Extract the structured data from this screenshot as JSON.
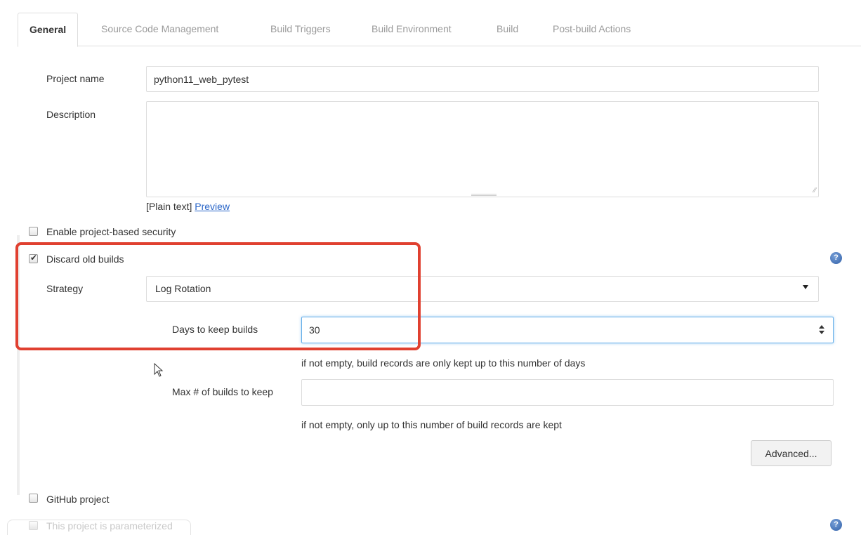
{
  "tabs": [
    {
      "label": "General",
      "active": true
    },
    {
      "label": "Source Code Management",
      "active": false
    },
    {
      "label": "Build Triggers",
      "active": false
    },
    {
      "label": "Build Environment",
      "active": false
    },
    {
      "label": "Build",
      "active": false
    },
    {
      "label": "Post-build Actions",
      "active": false
    }
  ],
  "project": {
    "name_label": "Project name",
    "name_value": "python11_web_pytest",
    "description_label": "Description",
    "description_value": "",
    "plain_text": "[Plain text]",
    "preview_link": "Preview"
  },
  "options": {
    "project_security_label": "Enable project-based security",
    "project_security_checked": false,
    "discard_old_builds_label": "Discard old builds",
    "discard_old_builds_checked": true,
    "github_project_label": "GitHub project",
    "github_project_checked": false,
    "parameterized_label": "This project is parameterized",
    "parameterized_checked": false
  },
  "discard": {
    "strategy_label": "Strategy",
    "strategy_value": "Log Rotation",
    "days_label": "Days to keep builds",
    "days_value": "30",
    "days_hint": "if not empty, build records are only kept up to this number of days",
    "max_label": "Max # of builds to keep",
    "max_value": "",
    "max_hint": "if not empty, only up to this number of build records are kept",
    "advanced_button": "Advanced..."
  },
  "icons": {
    "help": "question-mark-icon",
    "help_glyph": "?"
  },
  "colors": {
    "highlight": "#e04030",
    "link": "#2a66c8",
    "focus_border": "#66afe9"
  }
}
